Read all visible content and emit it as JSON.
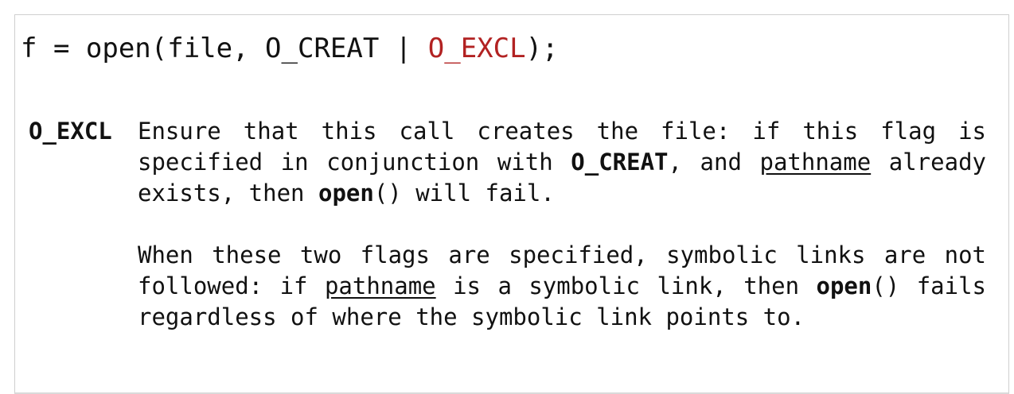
{
  "code": {
    "prefix": "f = open(file, O_CREAT | ",
    "highlight": "O_EXCL",
    "suffix": ");",
    "highlight_color": "#b22222"
  },
  "entry": {
    "term": "O_EXCL",
    "paragraph1": {
      "t1": "Ensure that this call creates the file: if this flag is specified in conjunction with ",
      "flag": "O_CREAT",
      "t2": ", and ",
      "arg": "pathname",
      "t3": " already exists, then ",
      "func": "open",
      "t4": "() will fail."
    },
    "paragraph2": {
      "t1": "When these two flags are specified, symbolic links are not followed: if ",
      "arg": "pathname",
      "t2": " is a symbolic link, then ",
      "func": "open",
      "t3": "() fails regardless of where the symbolic link points to."
    }
  }
}
